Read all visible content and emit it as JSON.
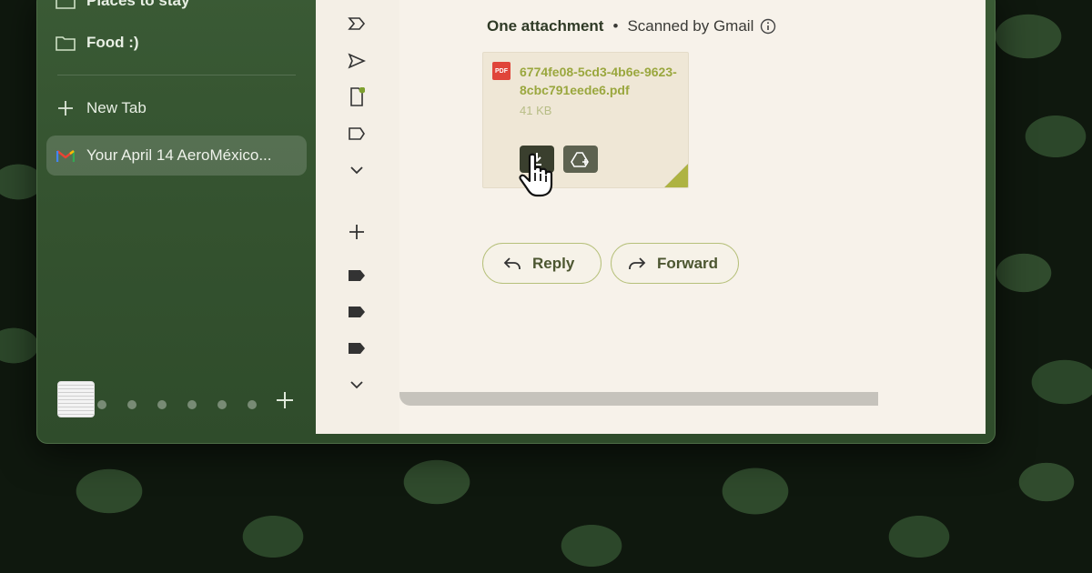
{
  "sidebar": {
    "items": [
      {
        "label": "Places to stay",
        "icon": "folder-icon"
      },
      {
        "label": "Food :)",
        "icon": "folder-icon"
      },
      {
        "label": "New Tab",
        "icon": "plus-icon"
      },
      {
        "label": "Your April 14 AeroMéxico...",
        "icon": "gmail-icon"
      }
    ]
  },
  "attachments": {
    "header_title": "One attachment",
    "separator": "•",
    "scan_text": "Scanned by Gmail",
    "file": {
      "badge": "PDF",
      "name": "6774fe08-5cd3-4b6e-9623-8cbc791eede6.pdf",
      "size": "41 KB"
    }
  },
  "actions": {
    "reply_label": "Reply",
    "forward_label": "Forward"
  },
  "colors": {
    "accent": "#9aa73e",
    "window_green": "#34522f",
    "panel_bg": "#f6f1e8",
    "pdf_red": "#e0453a"
  }
}
